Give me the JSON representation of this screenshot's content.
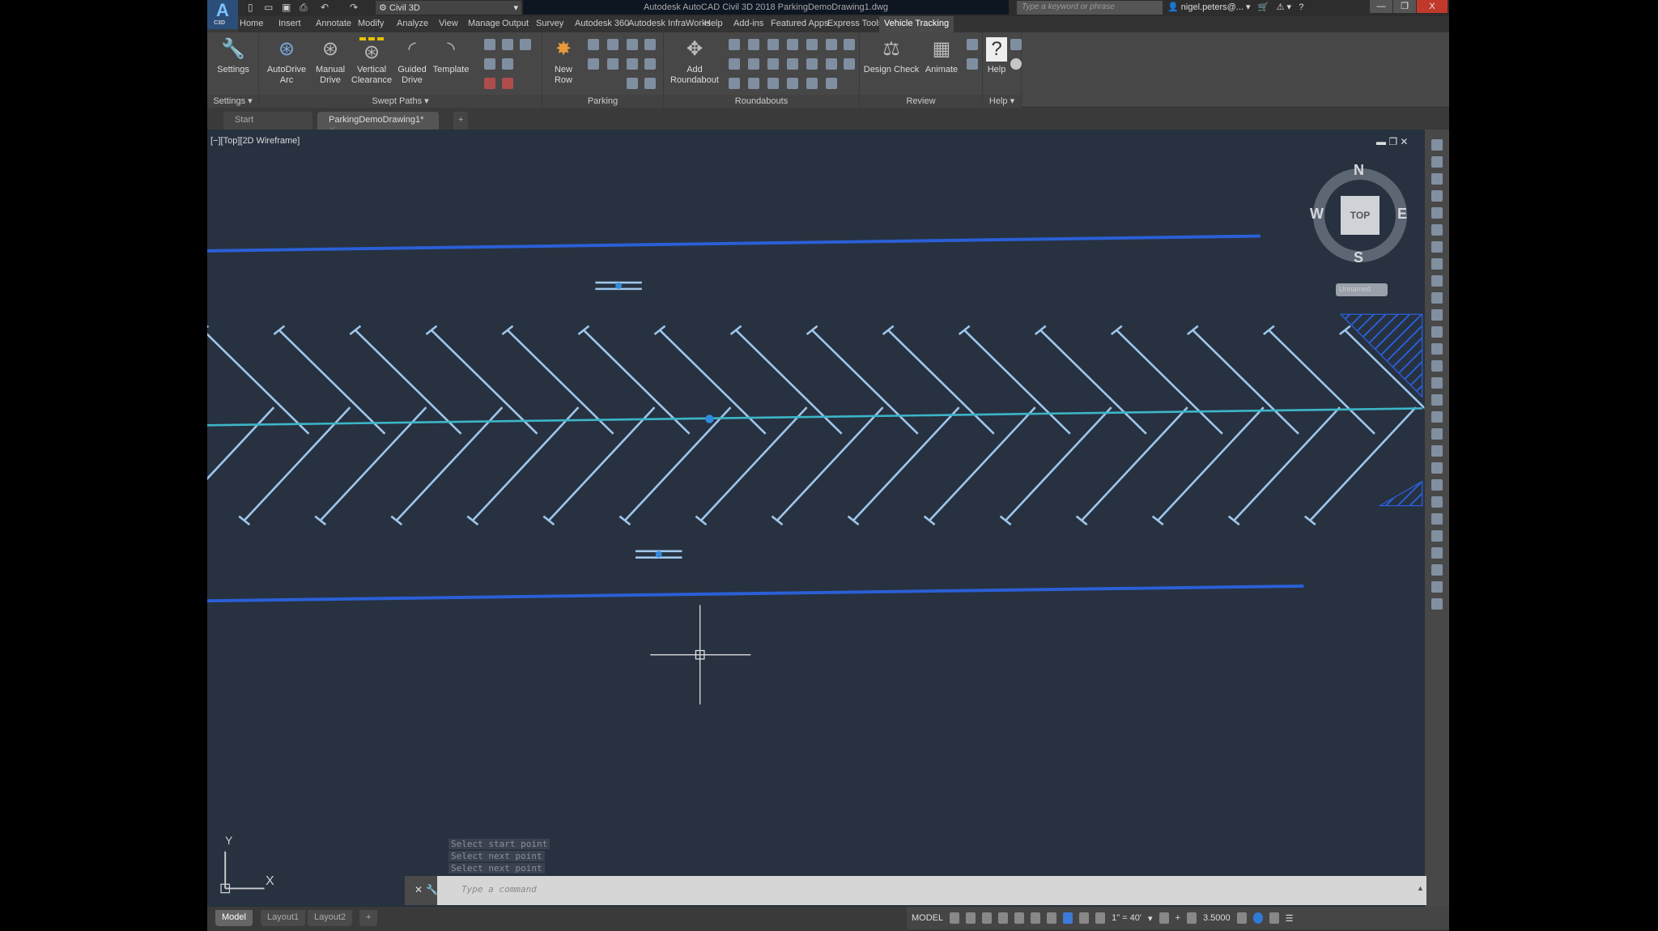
{
  "titlebar": {
    "app_logo": "A",
    "app_logo_sub": "C3D",
    "workspace": "Civil 3D",
    "title": "Autodesk AutoCAD Civil 3D 2018   ParkingDemoDrawing1.dwg",
    "search_placeholder": "Type a keyword or phrase",
    "user": "nigel.peters@...",
    "window_buttons": [
      "—",
      "❐",
      "X"
    ]
  },
  "menu_tabs": [
    "Home",
    "Insert",
    "Annotate",
    "Modify",
    "Analyze",
    "View",
    "Manage",
    "Output",
    "Survey",
    "Autodesk 360",
    "Autodesk InfraWorks",
    "Help",
    "Add-ins",
    "Featured Apps",
    "Express Tools",
    "Vehicle Tracking"
  ],
  "active_tab": "Vehicle Tracking",
  "ribbon": {
    "settings": {
      "label": "Settings",
      "buttons": [
        "Settings"
      ]
    },
    "swept_paths": {
      "label": "Swept Paths",
      "buttons": [
        "AutoDrive Arc",
        "Manual Drive",
        "Vertical Clearance",
        "Guided Drive",
        "Template"
      ]
    },
    "parking": {
      "label": "Parking",
      "buttons": [
        "New Row"
      ]
    },
    "roundabouts": {
      "label": "Roundabouts",
      "buttons": [
        "Add Roundabout"
      ]
    },
    "review": {
      "label": "Review",
      "buttons": [
        "Design Check",
        "Animate"
      ]
    },
    "help": {
      "label": "Help",
      "buttons": [
        "Help"
      ]
    }
  },
  "doc_tabs": [
    "Start",
    "ParkingDemoDrawing1*"
  ],
  "viewport": {
    "label": "[−][Top][2D Wireframe]",
    "viewcube": {
      "face": "TOP",
      "n": "N",
      "s": "S",
      "e": "E",
      "w": "W",
      "ucs": "Unnamed"
    },
    "ucs_x": "X",
    "ucs_y": "Y"
  },
  "command": {
    "history": [
      "Select start point",
      "Select next point",
      "Select next point"
    ],
    "placeholder": "Type a command"
  },
  "layout_tabs": [
    "Model",
    "Layout1",
    "Layout2"
  ],
  "status": {
    "model": "MODEL",
    "scale": "1\" = 40'",
    "precision": "3.5000"
  },
  "colors": {
    "boundary": "#2a5fd6",
    "centerline": "#3cb6c8",
    "stall": "#9fc6ea",
    "background": "#273140"
  }
}
